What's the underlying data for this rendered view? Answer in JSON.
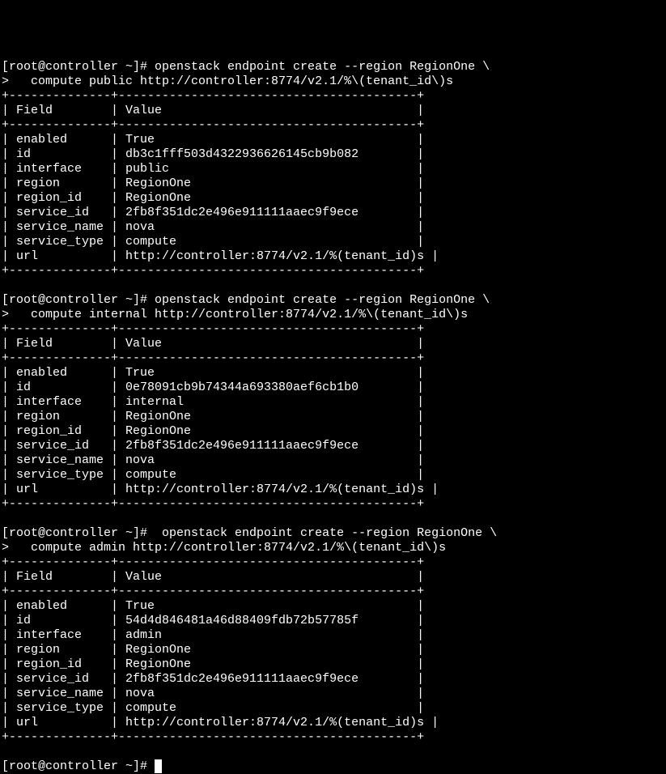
{
  "commands": {
    "cmd1_line1": "[root@controller ~]# openstack endpoint create --region RegionOne \\",
    "cmd1_line2": ">   compute public http://controller:8774/v2.1/%\\(tenant_id\\)s",
    "cmd2_line1": "[root@controller ~]# openstack endpoint create --region RegionOne \\",
    "cmd2_line2": ">   compute internal http://controller:8774/v2.1/%\\(tenant_id\\)s",
    "cmd3_line1": "[root@controller ~]#  openstack endpoint create --region RegionOne \\",
    "cmd3_line2": ">   compute admin http://controller:8774/v2.1/%\\(tenant_id\\)s",
    "final_prompt": "[root@controller ~]# "
  },
  "tables": {
    "border_top": "+--------------+-----------------------------------------+",
    "border_mid": "+--------------+-----------------------------------------+",
    "border_bot": "+--------------+-----------------------------------------+",
    "header": "| Field        | Value                                   |",
    "t1": {
      "r1": "| enabled      | True                                    |",
      "r2": "| id           | db3c1fff503d4322936626145cb9b082        |",
      "r3": "| interface    | public                                  |",
      "r4": "| region       | RegionOne                               |",
      "r5": "| region_id    | RegionOne                               |",
      "r6": "| service_id   | 2fb8f351dc2e496e911111aaec9f9ece        |",
      "r7": "| service_name | nova                                    |",
      "r8": "| service_type | compute                                 |",
      "r9": "| url          | http://controller:8774/v2.1/%(tenant_id)s |"
    },
    "t2": {
      "r1": "| enabled      | True                                    |",
      "r2": "| id           | 0e78091cb9b74344a693380aef6cb1b0        |",
      "r3": "| interface    | internal                                |",
      "r4": "| region       | RegionOne                               |",
      "r5": "| region_id    | RegionOne                               |",
      "r6": "| service_id   | 2fb8f351dc2e496e911111aaec9f9ece        |",
      "r7": "| service_name | nova                                    |",
      "r8": "| service_type | compute                                 |",
      "r9": "| url          | http://controller:8774/v2.1/%(tenant_id)s |"
    },
    "t3": {
      "r1": "| enabled      | True                                    |",
      "r2": "| id           | 54d4d846481a46d88409fdb72b57785f        |",
      "r3": "| interface    | admin                                   |",
      "r4": "| region       | RegionOne                               |",
      "r5": "| region_id    | RegionOne                               |",
      "r6": "| service_id   | 2fb8f351dc2e496e911111aaec9f9ece        |",
      "r7": "| service_name | nova                                    |",
      "r8": "| service_type | compute                                 |",
      "r9": "| url          | http://controller:8774/v2.1/%(tenant_id)s |"
    }
  },
  "blank": ""
}
